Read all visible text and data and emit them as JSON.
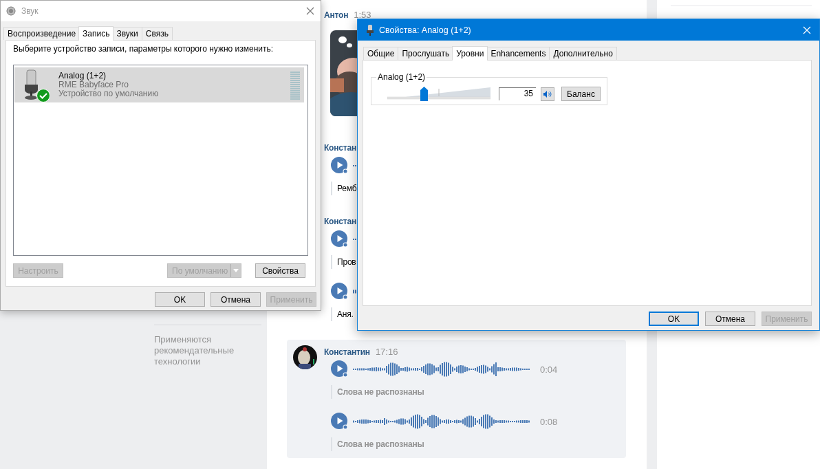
{
  "page": {
    "sidebar_note": "Применяются рекомендательные технологии",
    "messages": [
      {
        "author": "Антон",
        "time": "1:53",
        "highlighted": false
      },
      {
        "author": "Констан",
        "kind": "voice",
        "highlighted": false,
        "voice": [
          {
            "transcript": "Ремб",
            "recognized": true
          }
        ]
      },
      {
        "author": "Констан",
        "kind": "voice",
        "highlighted": false,
        "voice": [
          {
            "transcript": "Пров",
            "recognized": true
          },
          {
            "transcript": "Аня.",
            "recognized": true
          }
        ]
      },
      {
        "author": "Константин",
        "time": "17:16",
        "kind": "voice",
        "highlighted": true,
        "voice": [
          {
            "duration": "0:04",
            "transcript": "Слова не распознаны",
            "recognized": false
          },
          {
            "duration": "0:08",
            "transcript": "Слова не распознаны",
            "recognized": false
          }
        ]
      }
    ]
  },
  "sound_dialog": {
    "title": "Звук",
    "active": false,
    "tabs": [
      {
        "label": "Воспроизведение",
        "selected": false
      },
      {
        "label": "Запись",
        "selected": true
      },
      {
        "label": "Звуки",
        "selected": false
      },
      {
        "label": "Связь",
        "selected": false
      }
    ],
    "instruction": "Выберите устройство записи, параметры которого нужно изменить:",
    "devices": [
      {
        "name": "Analog (1+2)",
        "driver": "RME Babyface Pro",
        "status": "Устройство по умолчанию",
        "selected": true,
        "default": true
      }
    ],
    "buttons": [
      {
        "label": "Настроить",
        "disabled": true,
        "kind": "plain"
      },
      {
        "label": "По умолчанию",
        "disabled": true,
        "kind": "split"
      },
      {
        "label": "Свойства",
        "disabled": false,
        "kind": "plain"
      }
    ],
    "footer_buttons": [
      {
        "label": "OK",
        "disabled": false,
        "default": false
      },
      {
        "label": "Отмена",
        "disabled": false,
        "default": false
      },
      {
        "label": "Применить",
        "disabled": true,
        "default": false
      }
    ]
  },
  "properties_dialog": {
    "title": "Свойства: Analog (1+2)",
    "active": true,
    "tabs": [
      {
        "label": "Общие",
        "selected": false
      },
      {
        "label": "Прослушать",
        "selected": false
      },
      {
        "label": "Уровни",
        "selected": true
      },
      {
        "label": "Enhancements",
        "selected": false
      },
      {
        "label": "Дополнительно",
        "selected": false
      }
    ],
    "group_label": "Analog (1+2)",
    "volume": {
      "level": 0.35,
      "value": "35",
      "muted": false
    },
    "balance_button": "Баланс",
    "footer_buttons": [
      {
        "label": "OK",
        "disabled": false,
        "default": true
      },
      {
        "label": "Отмена",
        "disabled": false,
        "default": false
      },
      {
        "label": "Применить",
        "disabled": true,
        "default": false
      }
    ]
  }
}
